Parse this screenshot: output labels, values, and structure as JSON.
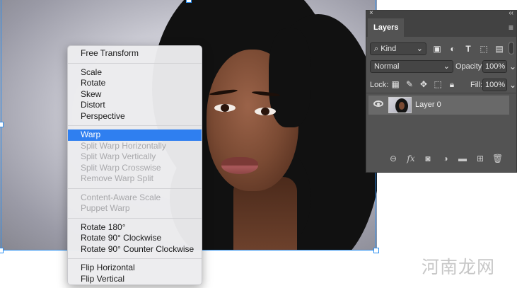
{
  "context_menu": {
    "groups": [
      [
        {
          "label": "Free Transform",
          "enabled": true
        }
      ],
      [
        {
          "label": "Scale",
          "enabled": true
        },
        {
          "label": "Rotate",
          "enabled": true
        },
        {
          "label": "Skew",
          "enabled": true
        },
        {
          "label": "Distort",
          "enabled": true
        },
        {
          "label": "Perspective",
          "enabled": true
        }
      ],
      [
        {
          "label": "Warp",
          "enabled": true,
          "selected": true
        },
        {
          "label": "Split Warp Horizontally",
          "enabled": false
        },
        {
          "label": "Split Warp Vertically",
          "enabled": false
        },
        {
          "label": "Split Warp Crosswise",
          "enabled": false
        },
        {
          "label": "Remove Warp Split",
          "enabled": false
        }
      ],
      [
        {
          "label": "Content-Aware Scale",
          "enabled": false
        },
        {
          "label": "Puppet Warp",
          "enabled": false
        }
      ],
      [
        {
          "label": "Rotate 180°",
          "enabled": true
        },
        {
          "label": "Rotate 90° Clockwise",
          "enabled": true
        },
        {
          "label": "Rotate 90° Counter Clockwise",
          "enabled": true
        }
      ],
      [
        {
          "label": "Flip Horizontal",
          "enabled": true
        },
        {
          "label": "Flip Vertical",
          "enabled": true
        }
      ]
    ]
  },
  "layers_panel": {
    "close_glyph": "×",
    "collapse_glyph": "‹‹",
    "tab_label": "Layers",
    "menu_glyph": "≡",
    "filter": {
      "value": "Kind",
      "search_glyph": "⌕"
    },
    "blend_mode": "Normal",
    "opacity_label": "Opacity:",
    "opacity_value": "100%",
    "lock_label": "Lock:",
    "fill_label": "Fill:",
    "fill_value": "100%",
    "layers": [
      {
        "name": "Layer 0",
        "visible": true
      }
    ],
    "filter_icons": [
      "image-filter-icon",
      "adjustment-filter-icon",
      "type-filter-icon",
      "shape-filter-icon",
      "smart-object-filter-icon"
    ],
    "bottom_icons": [
      "link-layers-icon",
      "fx-icon",
      "layer-mask-icon",
      "adjustment-layer-icon",
      "group-folder-icon",
      "new-layer-icon",
      "trash-icon"
    ],
    "fx_label": "fx"
  },
  "watermark": "河南龙网",
  "colors": {
    "accent": "#2f7ff0",
    "selection_frame": "#2b8ff0",
    "panel_bg": "#535353"
  }
}
